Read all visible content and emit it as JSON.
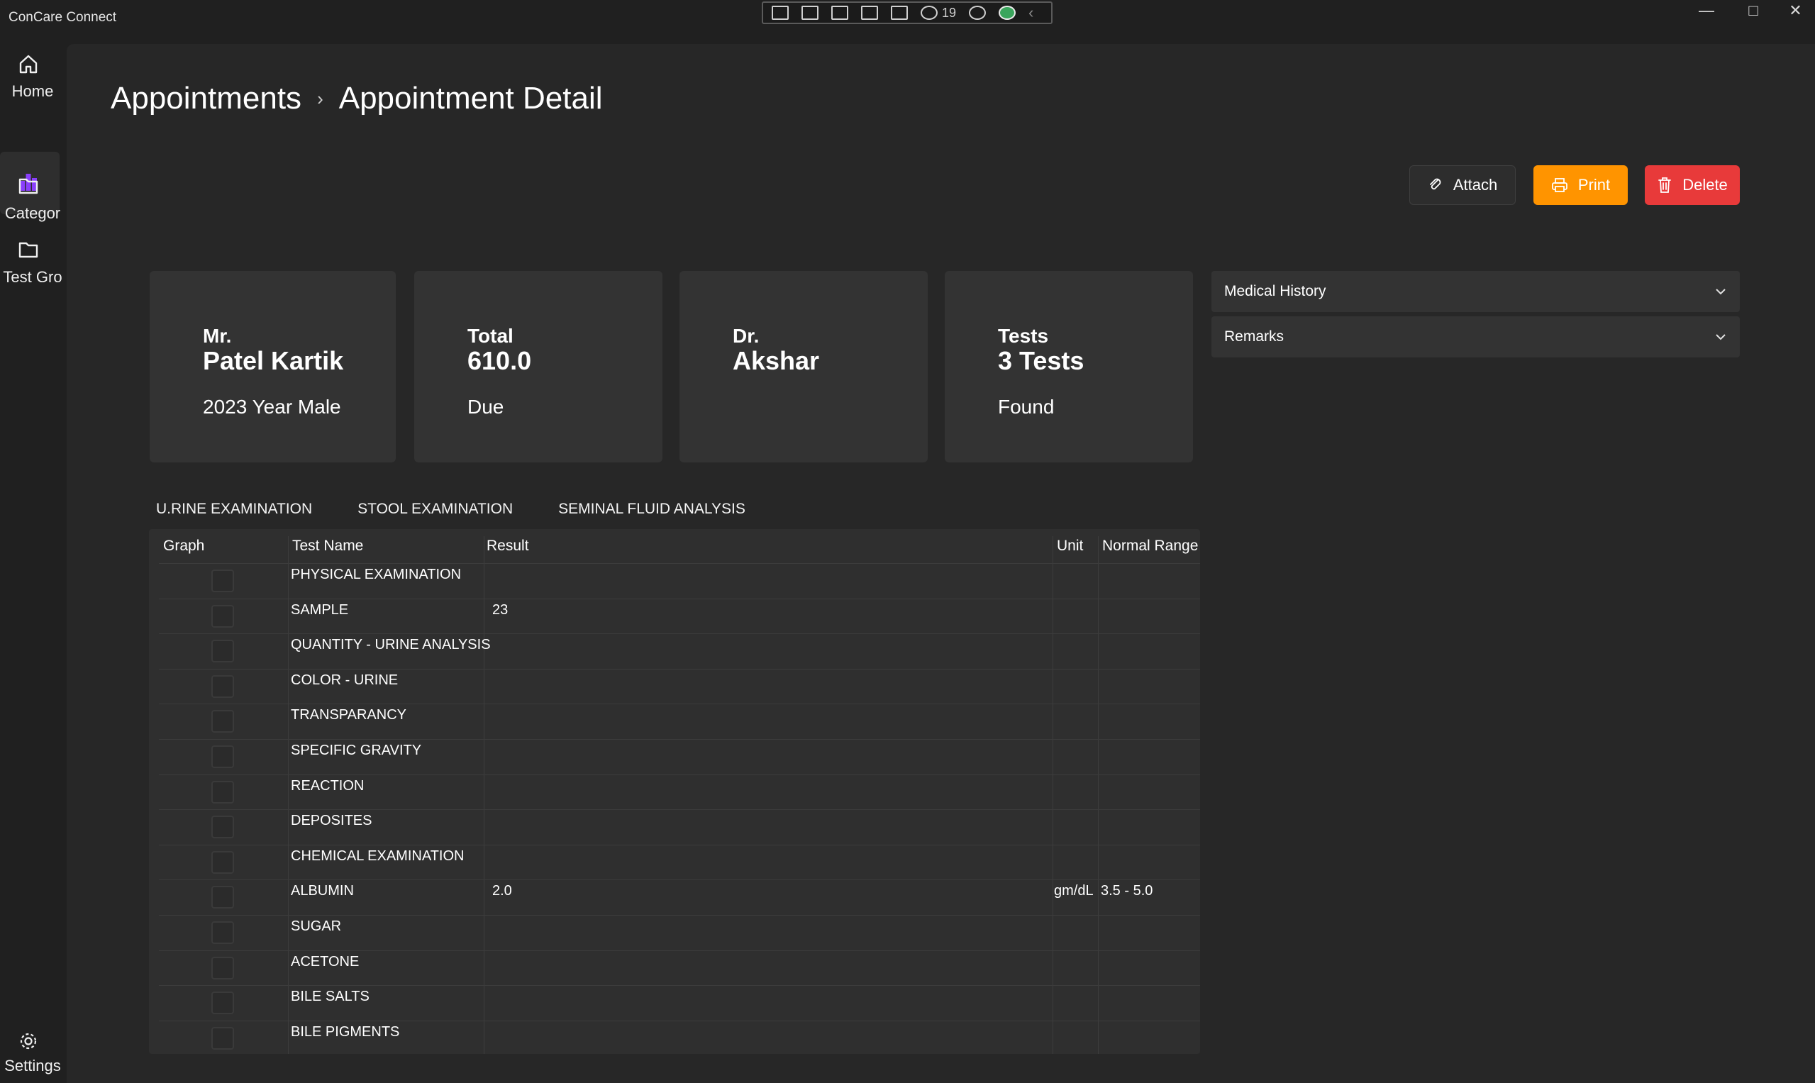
{
  "app": {
    "title": "ConCare Connect",
    "debug_badge_count": "19"
  },
  "nav": {
    "items": [
      {
        "label": "Home",
        "icon": "home-icon"
      },
      {
        "label": "",
        "icon": "bar-chart-icon"
      },
      {
        "label": "Categor",
        "icon": "folder-icon"
      },
      {
        "label": "Test Gro",
        "icon": "folder-icon"
      }
    ],
    "settings_label": "Settings"
  },
  "breadcrumb": {
    "parent": "Appointments",
    "current": "Appointment Detail"
  },
  "actions": {
    "attach": "Attach",
    "print": "Print",
    "delete": "Delete"
  },
  "colors": {
    "accent_purple": "#8a3ffc",
    "print_orange": "#ff9400",
    "delete_red": "#e83a3a"
  },
  "cards": {
    "patient": {
      "line1": "Mr.",
      "line2": "Patel Kartik",
      "line3": "2023 Year Male"
    },
    "total": {
      "line1": "Total",
      "line2": "610.0",
      "line3": "Due"
    },
    "doctor": {
      "line1": "Dr.",
      "line2": "Akshar",
      "line3": ""
    },
    "tests": {
      "line1": "Tests",
      "line2": "3 Tests",
      "line3": "Found"
    }
  },
  "expanders": {
    "medical_history": "Medical History",
    "remarks": "Remarks"
  },
  "tabs": [
    "U.RINE EXAMINATION",
    "STOOL EXAMINATION",
    "SEMINAL FLUID ANALYSIS"
  ],
  "table": {
    "headers": {
      "graph": "Graph",
      "test_name": "Test Name",
      "result": "Result",
      "unit": "Unit",
      "normal_range": "Normal Range"
    },
    "rows": [
      {
        "name": "PHYSICAL EXAMINATION",
        "result": "",
        "unit": "",
        "range": ""
      },
      {
        "name": "SAMPLE",
        "result": "23",
        "unit": "",
        "range": ""
      },
      {
        "name": "QUANTITY - URINE ANALYSIS",
        "result": "",
        "unit": "",
        "range": ""
      },
      {
        "name": "COLOR - URINE",
        "result": "",
        "unit": "",
        "range": ""
      },
      {
        "name": "TRANSPARANCY",
        "result": "",
        "unit": "",
        "range": ""
      },
      {
        "name": "SPECIFIC GRAVITY",
        "result": "",
        "unit": "",
        "range": ""
      },
      {
        "name": "REACTION",
        "result": "",
        "unit": "",
        "range": ""
      },
      {
        "name": "DEPOSITES",
        "result": "",
        "unit": "",
        "range": ""
      },
      {
        "name": "CHEMICAL EXAMINATION",
        "result": "",
        "unit": "",
        "range": ""
      },
      {
        "name": "ALBUMIN",
        "result": "2.0",
        "unit": "gm/dL",
        "range": "3.5 - 5.0"
      },
      {
        "name": "SUGAR",
        "result": "",
        "unit": "",
        "range": ""
      },
      {
        "name": "ACETONE",
        "result": "",
        "unit": "",
        "range": ""
      },
      {
        "name": "BILE SALTS",
        "result": "",
        "unit": "",
        "range": ""
      },
      {
        "name": "BILE PIGMENTS",
        "result": "",
        "unit": "",
        "range": ""
      }
    ]
  }
}
